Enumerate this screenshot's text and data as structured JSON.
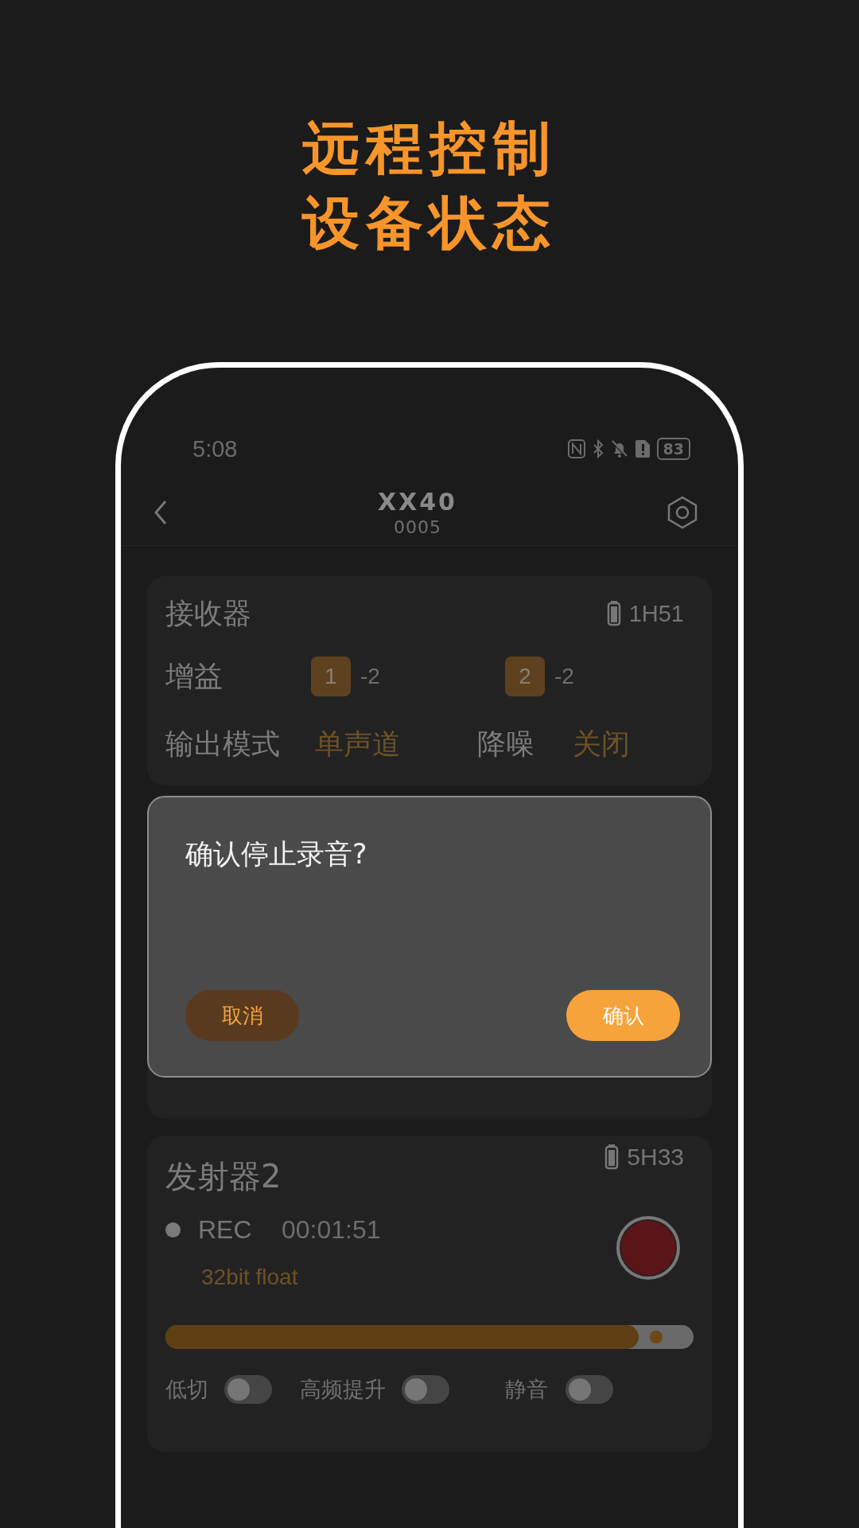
{
  "headline": [
    "远程控制",
    "设备状态"
  ],
  "status_bar": {
    "time": "5:08",
    "battery": "83"
  },
  "header": {
    "title": "XX40",
    "subtitle": "0005"
  },
  "receiver": {
    "title": "接收器",
    "battery": "1H51",
    "gain_label": "增益",
    "channels": [
      {
        "label": "1",
        "value": "-2"
      },
      {
        "label": "2",
        "value": "-2"
      }
    ],
    "output_label": "输出模式",
    "output_value": "单声道",
    "noise_label": "降噪",
    "noise_value": "关闭"
  },
  "dialog": {
    "message": "确认停止录音?",
    "buttons": [
      {
        "label": "取消",
        "kind": "cancel"
      },
      {
        "label": "确认",
        "kind": "confirm"
      }
    ]
  },
  "transmitter": {
    "title": "发射器2",
    "battery": "5H33",
    "rec_label": "REC",
    "rec_time": "00:01:51",
    "format": "32bit float",
    "level": 0.896,
    "toggles": [
      {
        "label": "低切",
        "on": false
      },
      {
        "label": "高频提升",
        "on": false
      },
      {
        "label": "静音",
        "on": false
      }
    ]
  }
}
